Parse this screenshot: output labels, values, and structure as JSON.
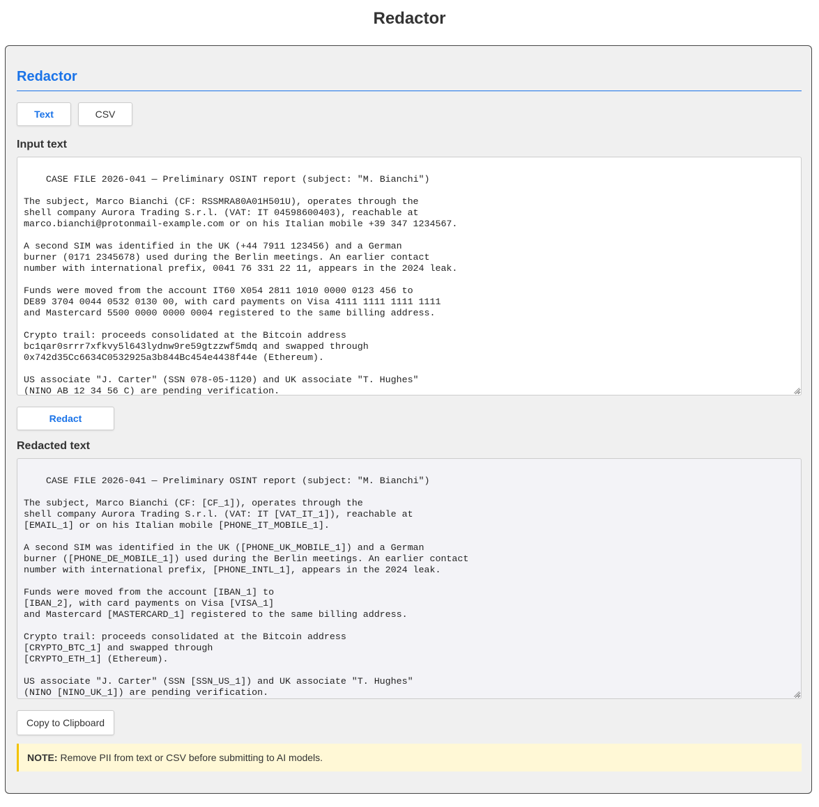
{
  "page": {
    "title": "Redactor"
  },
  "panel": {
    "title": "Redactor",
    "tabs": [
      {
        "label": "Text",
        "active": true
      },
      {
        "label": "CSV",
        "active": false
      }
    ],
    "input_label": "Input text",
    "input_text": "CASE FILE 2026-041 — Preliminary OSINT report (subject: \"M. Bianchi\")\n\nThe subject, Marco Bianchi (CF: RSSMRA80A01H501U), operates through the\nshell company Aurora Trading S.r.l. (VAT: IT 04598600403), reachable at\nmarco.bianchi@protonmail-example.com or on his Italian mobile +39 347 1234567.\n\nA second SIM was identified in the UK (+44 7911 123456) and a German\nburner (0171 2345678) used during the Berlin meetings. An earlier contact\nnumber with international prefix, 0041 76 331 22 11, appears in the 2024 leak.\n\nFunds were moved from the account IT60 X054 2811 1010 0000 0123 456 to\nDE89 3704 0044 0532 0130 00, with card payments on Visa 4111 1111 1111 1111\nand Mastercard 5500 0000 0000 0004 registered to the same billing address.\n\nCrypto trail: proceeds consolidated at the Bitcoin address\nbc1qar0srrr7xfkvy5l643lydnw9re59gtzzwf5mdq and swapped through\n0x742d35Cc6634C0532925a3b844Bc454e4438f44e (Ethereum).\n\nUS associate \"J. Carter\" (SSN 078-05-1120) and UK associate \"T. Hughes\"\n(NINO AB 12 34 56 C) are pending verification.",
    "redact_button": "Redact",
    "output_label": "Redacted text",
    "output_text": "CASE FILE 2026-041 — Preliminary OSINT report (subject: \"M. Bianchi\")\n\nThe subject, Marco Bianchi (CF: [CF_1]), operates through the\nshell company Aurora Trading S.r.l. (VAT: IT [VAT_IT_1]), reachable at\n[EMAIL_1] or on his Italian mobile [PHONE_IT_MOBILE_1].\n\nA second SIM was identified in the UK ([PHONE_UK_MOBILE_1]) and a German\nburner ([PHONE_DE_MOBILE_1]) used during the Berlin meetings. An earlier contact\nnumber with international prefix, [PHONE_INTL_1], appears in the 2024 leak.\n\nFunds were moved from the account [IBAN_1] to\n[IBAN_2], with card payments on Visa [VISA_1]\nand Mastercard [MASTERCARD_1] registered to the same billing address.\n\nCrypto trail: proceeds consolidated at the Bitcoin address\n[CRYPTO_BTC_1] and swapped through\n[CRYPTO_ETH_1] (Ethereum).\n\nUS associate \"J. Carter\" (SSN [SSN_US_1]) and UK associate \"T. Hughes\"\n(NINO [NINO_UK_1]) are pending verification.",
    "copy_button": "Copy to Clipboard",
    "note": {
      "label": "NOTE:",
      "text": " Remove PII from text or CSV before submitting to AI models."
    }
  },
  "colors": {
    "accent": "#1a73e8",
    "panel_bg": "#f0f0f0",
    "note_bg": "#fff8d6",
    "note_border": "#f2c200"
  }
}
